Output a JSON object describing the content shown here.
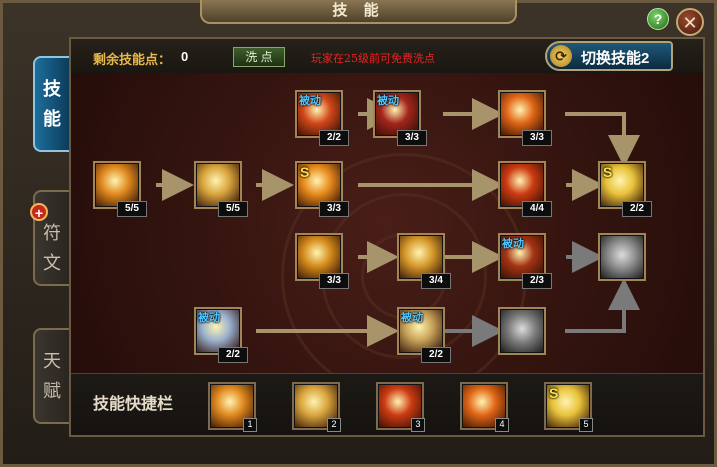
{
  "window": {
    "title": "技 能"
  },
  "controls": {
    "help": "?",
    "close": "✕"
  },
  "tabs": [
    {
      "label": "技能",
      "chars": [
        "技",
        "能"
      ],
      "active": true
    },
    {
      "label": "符文",
      "chars": [
        "符",
        "文"
      ],
      "active": false
    },
    {
      "label": "天赋",
      "chars": [
        "天",
        "赋"
      ],
      "active": false
    }
  ],
  "rune_plus": "+",
  "header": {
    "remaining_label": "剩余技能点：",
    "remaining_value": "0",
    "reset_button": "洗 点",
    "reset_note": "玩家在25级前可免费洗点",
    "switch_button": "切换技能2"
  },
  "passive_label": "被动",
  "s_badge": "S",
  "skills": [
    {
      "id": "r1c2",
      "level": "2/2",
      "passive": true,
      "icon": "fire-fist-icon",
      "color": "#d2481a"
    },
    {
      "id": "r1c3",
      "level": "3/3",
      "passive": true,
      "icon": "winged-helm-icon",
      "color": "#a3261d"
    },
    {
      "id": "r1c4",
      "level": "3/3",
      "passive": false,
      "icon": "dark-crescent-icon",
      "color": "#e06616"
    },
    {
      "id": "r2c0",
      "level": "5/5",
      "passive": false,
      "icon": "slash-arc-icon",
      "color": "#e0891f"
    },
    {
      "id": "r2c1",
      "level": "5/5",
      "passive": false,
      "icon": "blade-strike-icon",
      "color": "#d9a53d"
    },
    {
      "id": "r2c2",
      "level": "3/3",
      "passive": false,
      "super": true,
      "icon": "sword-burst-icon",
      "color": "#e88a1c"
    },
    {
      "id": "r2c4",
      "level": "4/4",
      "passive": false,
      "icon": "fire-vortex-icon",
      "color": "#cc3b12"
    },
    {
      "id": "r2c5",
      "level": "2/2",
      "passive": false,
      "super": true,
      "icon": "golden-aura-icon",
      "color": "#e8c23a"
    },
    {
      "id": "r3c2",
      "level": "3/3",
      "passive": false,
      "icon": "flame-shield-icon",
      "color": "#d48b1c"
    },
    {
      "id": "r3c3",
      "level": "3/4",
      "passive": false,
      "icon": "sword-clash-icon",
      "color": "#d79a2c"
    },
    {
      "id": "r3c4",
      "level": "2/3",
      "passive": true,
      "icon": "demon-form-icon",
      "color": "#a53414"
    },
    {
      "id": "r3c5",
      "level": "",
      "passive": false,
      "icon": "guardian-angel-icon",
      "color": "#8a8a8a"
    },
    {
      "id": "r4c1",
      "level": "2/2",
      "passive": true,
      "icon": "stone-fist-icon",
      "color": "#9cb3d1"
    },
    {
      "id": "r4c3",
      "level": "2/2",
      "passive": true,
      "icon": "swords-cross-icon",
      "color": "#c9a35a"
    },
    {
      "id": "r4c4",
      "level": "",
      "passive": false,
      "icon": "berserker-icon",
      "color": "#7a7a7a"
    }
  ],
  "hotbar": {
    "label": "技能快捷栏",
    "slots": [
      {
        "number": "1",
        "icon": "slash-arc-icon",
        "color": "#e0891f"
      },
      {
        "number": "2",
        "icon": "blade-strike-icon",
        "color": "#d9a53d"
      },
      {
        "number": "3",
        "icon": "fire-vortex-icon",
        "color": "#cc3b12"
      },
      {
        "number": "4",
        "icon": "dark-crescent-icon",
        "color": "#e06616"
      },
      {
        "number": "5",
        "icon": "golden-aura-icon",
        "color": "#e8c23a",
        "super": true
      }
    ]
  }
}
